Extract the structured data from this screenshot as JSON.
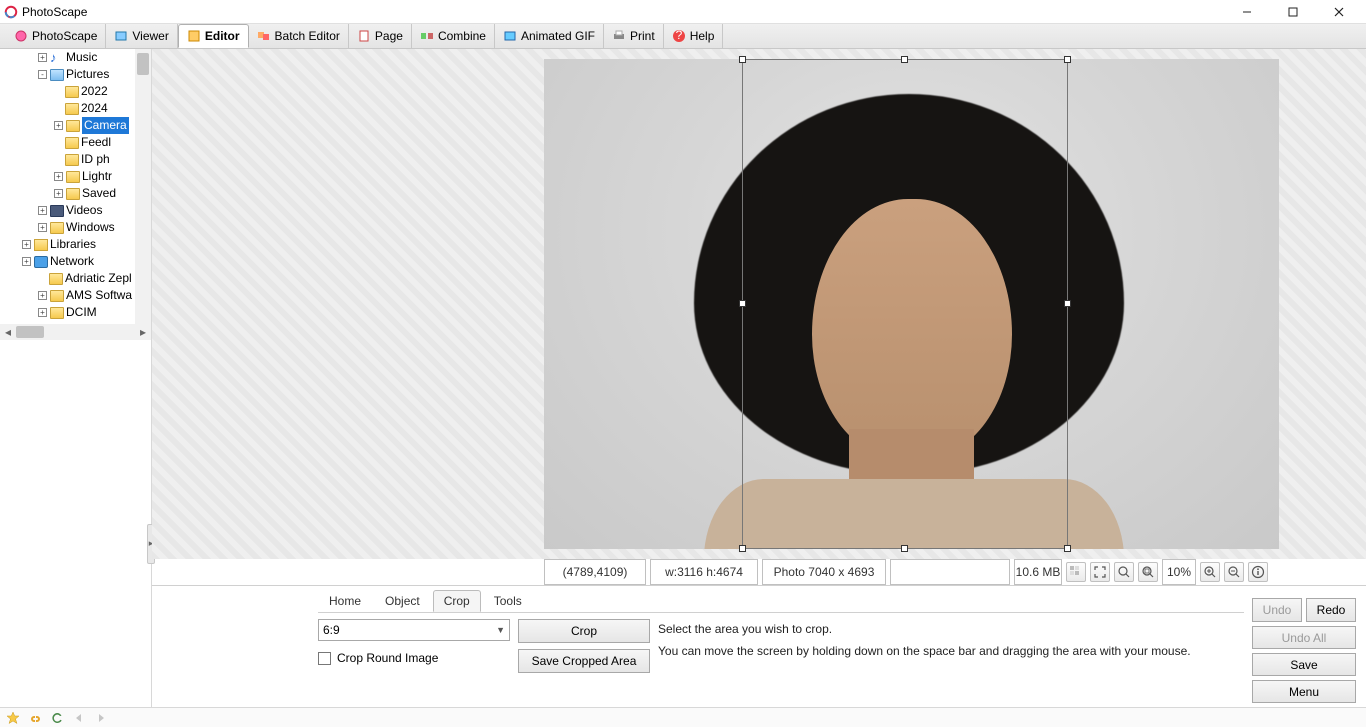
{
  "window": {
    "title": "PhotoScape"
  },
  "toolbar": {
    "tabs": [
      {
        "label": "PhotoScape"
      },
      {
        "label": "Viewer"
      },
      {
        "label": "Editor"
      },
      {
        "label": "Batch Editor"
      },
      {
        "label": "Page"
      },
      {
        "label": "Combine"
      },
      {
        "label": "Animated GIF"
      },
      {
        "label": "Print"
      },
      {
        "label": "Help"
      }
    ],
    "active_index": 2
  },
  "tree": {
    "items": [
      {
        "indent": 1,
        "exp": "+",
        "icon": "music",
        "label": "Music"
      },
      {
        "indent": 1,
        "exp": "-",
        "icon": "pic",
        "label": "Pictures"
      },
      {
        "indent": 2,
        "exp": " ",
        "icon": "folder",
        "label": "2022"
      },
      {
        "indent": 2,
        "exp": " ",
        "icon": "folder",
        "label": "2024"
      },
      {
        "indent": 2,
        "exp": "+",
        "icon": "folder",
        "label": "Camera",
        "selected": true
      },
      {
        "indent": 2,
        "exp": " ",
        "icon": "folder",
        "label": "Feedl"
      },
      {
        "indent": 2,
        "exp": " ",
        "icon": "folder",
        "label": "ID ph"
      },
      {
        "indent": 2,
        "exp": "+",
        "icon": "folder",
        "label": "Lightr"
      },
      {
        "indent": 2,
        "exp": "+",
        "icon": "folder",
        "label": "Saved"
      },
      {
        "indent": 1,
        "exp": "+",
        "icon": "video",
        "label": "Videos"
      },
      {
        "indent": 1,
        "exp": "+",
        "icon": "folder",
        "label": "Windows"
      },
      {
        "indent": 0,
        "exp": "+",
        "icon": "lib",
        "label": "Libraries"
      },
      {
        "indent": 0,
        "exp": "+",
        "icon": "net",
        "label": "Network"
      },
      {
        "indent": 1,
        "exp": " ",
        "icon": "folder",
        "label": "Adriatic Zepl"
      },
      {
        "indent": 1,
        "exp": "+",
        "icon": "folder",
        "label": "AMS Softwa"
      },
      {
        "indent": 1,
        "exp": "+",
        "icon": "folder",
        "label": "DCIM"
      }
    ]
  },
  "status": {
    "coords": "(4789,4109)",
    "sel_size": "w:3116 h:4674",
    "photo_size": "Photo 7040 x 4693",
    "file_size": "10.6 MB",
    "zoom": "10%"
  },
  "bottom_tabs": {
    "items": [
      "Home",
      "Object",
      "Crop",
      "Tools"
    ],
    "active_index": 2
  },
  "crop": {
    "ratio": "6:9",
    "crop_btn": "Crop",
    "save_btn": "Save Cropped Area",
    "round_label": "Crop Round Image",
    "hint1": "Select the area you wish to crop.",
    "hint2": "You can move the screen by holding down on the space bar and dragging the area with your mouse."
  },
  "right_buttons": {
    "undo": "Undo",
    "redo": "Redo",
    "undo_all": "Undo All",
    "save": "Save",
    "menu": "Menu"
  }
}
